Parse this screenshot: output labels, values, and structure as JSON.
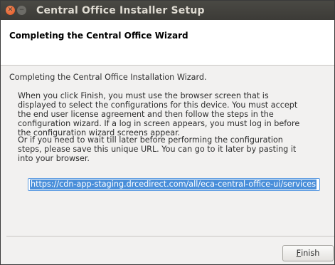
{
  "window": {
    "title": "Central Office Installer Setup",
    "close_glyph": "✕",
    "minimize_glyph": "−"
  },
  "header": {
    "title": "Completing the Central Office Wizard"
  },
  "content": {
    "intro": "Completing the Central Office Installation Wizard.",
    "paragraph1_lines": [
      "When you click Finish, you must use the browser screen that is",
      "displayed to select the configurations for this device. You must accept",
      "the end user license agreement and then follow the steps in the",
      "configuration wizard. If a log in screen appears, you must log in before",
      "the configuration wizard screens appear."
    ],
    "paragraph2_lines": [
      "Or if you need to wait till later before performing the configuration",
      "steps, please save this unique URL. You can go to it later by pasting it",
      "into your browser."
    ],
    "url_value": "https://cdn-app-staging.drcedirect.com/all/eca-central-office-ui/services"
  },
  "footer": {
    "finish_mnemonic": "F",
    "finish_rest": "inish"
  },
  "colors": {
    "titlebar": "#3c3b37",
    "close_button": "#e0531f",
    "selection": "#4a8fda"
  }
}
